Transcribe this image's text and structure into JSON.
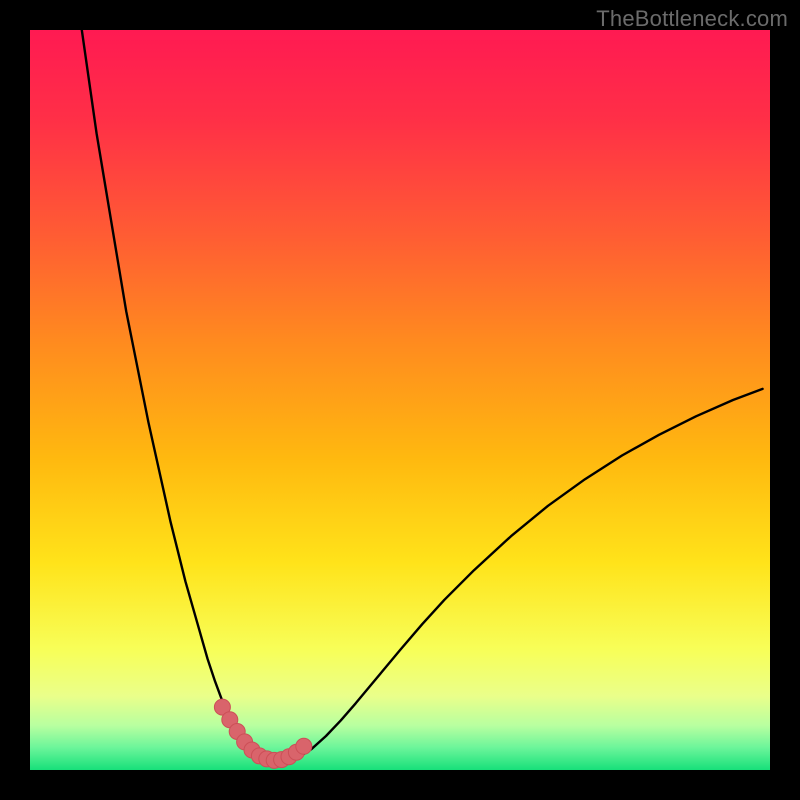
{
  "watermark": "TheBottleneck.com",
  "colors": {
    "frame": "#000000",
    "gradient_stops": [
      {
        "t": 0.0,
        "c": "#ff1a52"
      },
      {
        "t": 0.12,
        "c": "#ff2f47"
      },
      {
        "t": 0.28,
        "c": "#ff5d33"
      },
      {
        "t": 0.42,
        "c": "#ff8a1f"
      },
      {
        "t": 0.58,
        "c": "#ffb90f"
      },
      {
        "t": 0.72,
        "c": "#ffe31a"
      },
      {
        "t": 0.84,
        "c": "#f7ff5a"
      },
      {
        "t": 0.9,
        "c": "#eaff8a"
      },
      {
        "t": 0.94,
        "c": "#b8ffa0"
      },
      {
        "t": 0.97,
        "c": "#6bf59a"
      },
      {
        "t": 1.0,
        "c": "#17e07a"
      }
    ],
    "curve_stroke": "#000000",
    "marker_fill": "#d9646b",
    "marker_stroke": "#cc4f57"
  },
  "chart_data": {
    "type": "line",
    "title": "",
    "xlabel": "",
    "ylabel": "",
    "xlim": [
      0,
      100
    ],
    "ylim": [
      0,
      100
    ],
    "legend": false,
    "grid": false,
    "series": [
      {
        "name": "bottleneck-curve",
        "x": [
          7,
          8,
          9,
          10,
          11,
          12,
          13,
          14,
          15,
          16,
          17,
          18,
          19,
          20,
          21,
          22,
          23,
          24,
          25,
          26,
          27,
          28,
          29,
          30,
          32,
          34,
          36,
          38,
          40,
          42,
          44,
          46,
          48,
          50,
          53,
          56,
          60,
          65,
          70,
          75,
          80,
          85,
          90,
          95,
          99
        ],
        "values": [
          100,
          93,
          86,
          80,
          74,
          68,
          62,
          57,
          52,
          47,
          42.5,
          38,
          33.5,
          29.5,
          25.5,
          22,
          18.5,
          15,
          12,
          9.3,
          7,
          5.1,
          3.6,
          2.5,
          1.2,
          1.0,
          1.5,
          2.8,
          4.6,
          6.7,
          9.0,
          11.4,
          13.8,
          16.2,
          19.7,
          23.0,
          27.0,
          31.6,
          35.7,
          39.3,
          42.5,
          45.3,
          47.8,
          50.0,
          51.5
        ]
      }
    ],
    "markers": {
      "name": "dip-markers",
      "x": [
        26,
        27,
        28,
        29,
        30,
        31,
        32,
        33,
        34,
        35,
        36,
        37
      ],
      "values": [
        8.5,
        6.8,
        5.2,
        3.8,
        2.7,
        1.9,
        1.5,
        1.3,
        1.4,
        1.8,
        2.4,
        3.2
      ]
    }
  }
}
